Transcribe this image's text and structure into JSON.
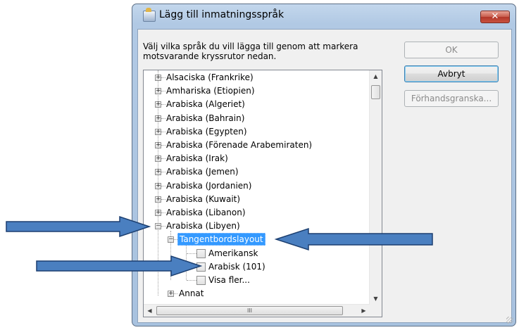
{
  "dialog": {
    "title": "Lägg till inmatningsspråk",
    "close_icon": "close-x-icon",
    "close_glyph": "✕",
    "instruction": "Välj vilka språk du vill lägga till genom att markera motsvarande kryssrutor nedan.",
    "buttons": {
      "ok": "OK",
      "cancel": "Avbryt",
      "preview": "Förhandsgranska..."
    }
  },
  "tree": {
    "languages": [
      "Alsaciska (Frankrike)",
      "Amhariska (Etiopien)",
      "Arabiska (Algeriet)",
      "Arabiska (Bahrain)",
      "Arabiska (Egypten)",
      "Arabiska (Förenade Arabemiraten)",
      "Arabiska (Irak)",
      "Arabiska (Jemen)",
      "Arabiska (Jordanien)",
      "Arabiska (Kuwait)",
      "Arabiska (Libanon)"
    ],
    "expanded_language": "Arabiska (Libyen)",
    "keyboard_group": "Tangentbordslayout",
    "keyboards": [
      "Amerikansk",
      "Arabisk (101)",
      "Visa fler..."
    ],
    "other_group": "Annat",
    "expander_plus": "+",
    "expander_minus": "−"
  },
  "scrollbars": {
    "up": "▲",
    "down": "▼",
    "left": "◀",
    "right": "▶",
    "grip": "III"
  },
  "colors": {
    "selection": "#3399ff",
    "annotation_arrow": "#4a7fc0",
    "annotation_arrow_border": "#1c3f70"
  }
}
